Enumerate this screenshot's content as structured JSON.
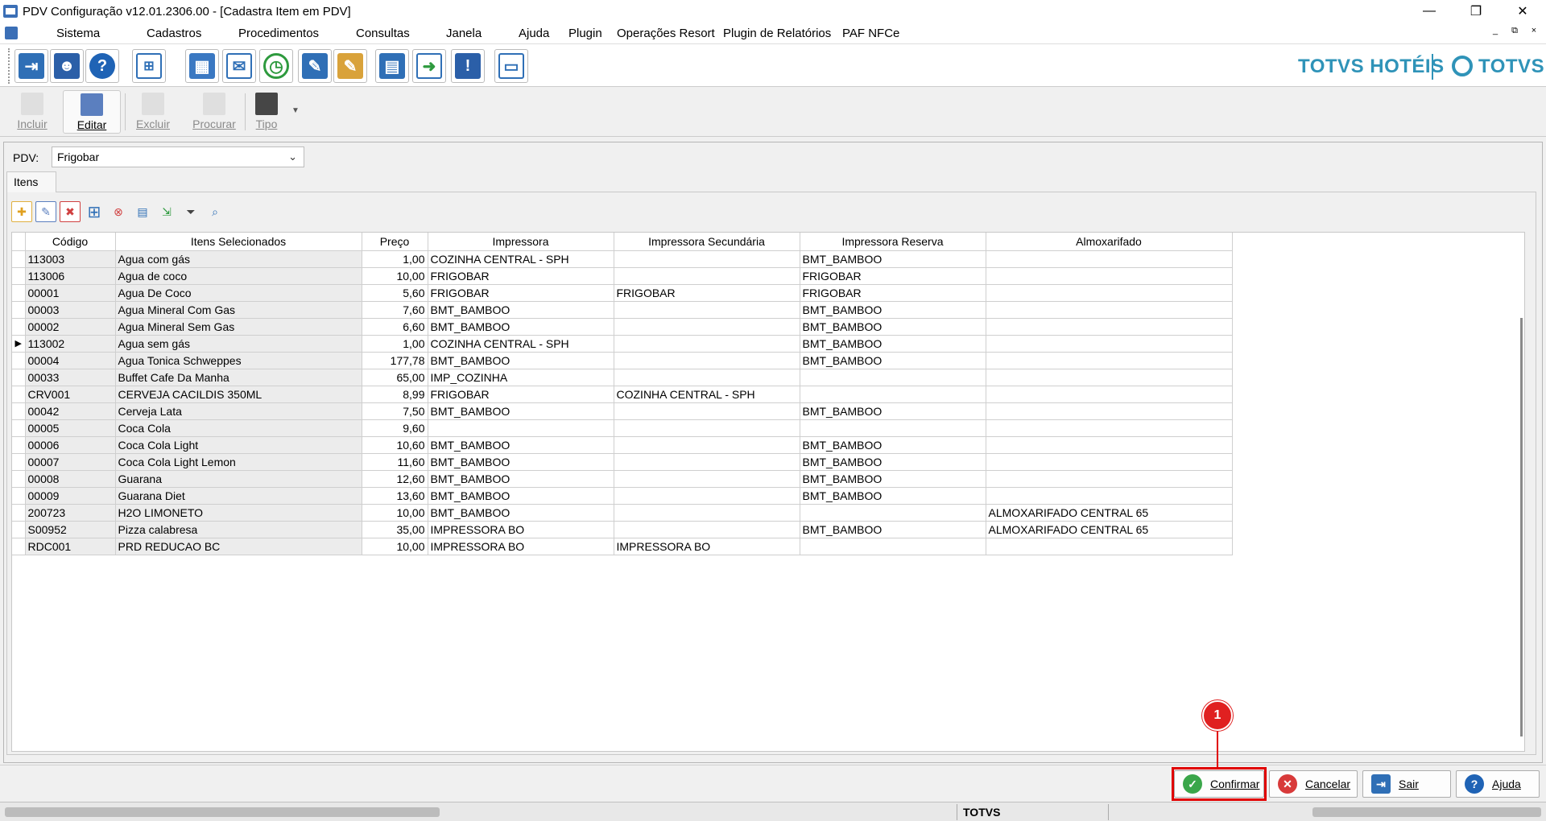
{
  "window": {
    "title": "PDV Configuração v12.01.2306.00 - [Cadastra Item em PDV]",
    "controls": [
      "—",
      "❐",
      "✕"
    ]
  },
  "menu": {
    "items": [
      "Sistema",
      "Cadastros",
      "Procedimentos",
      "Consultas",
      "Janela",
      "Ajuda",
      "Plugin",
      "Operações Resort",
      "Plugin de Relatórios",
      "PAF NFCe"
    ],
    "mdi_controls": [
      "_",
      "⧉",
      "×"
    ]
  },
  "brand": {
    "name": "TOTVS HOTÉIS",
    "logo_text": "TOTVS",
    "color": "#2f93b8"
  },
  "toolbar": {
    "incluir": "Incluir",
    "editar": "Editar",
    "excluir": "Excluir",
    "procurar": "Procurar",
    "tipo": "Tipo"
  },
  "form": {
    "pdv_label": "PDV:",
    "pdv_value": "Frigobar",
    "tab_label": "Itens"
  },
  "grid": {
    "headers": [
      "Código",
      "Itens Selecionados",
      "Preço",
      "Impressora",
      "Impressora Secundária",
      "Impressora Reserva",
      "Almoxarifado"
    ],
    "rows": [
      {
        "indicator": "",
        "codigo": "113003",
        "item": "Agua com gás",
        "preco": "1,00",
        "impressora": "COZINHA CENTRAL - SPH",
        "secundaria": "",
        "reserva": "BMT_BAMBOO",
        "almox": ""
      },
      {
        "indicator": "",
        "codigo": "113006",
        "item": "Agua de coco",
        "preco": "10,00",
        "impressora": "FRIGOBAR",
        "secundaria": "",
        "reserva": "FRIGOBAR",
        "almox": ""
      },
      {
        "indicator": "",
        "codigo": "00001",
        "item": "Agua De Coco",
        "preco": "5,60",
        "impressora": "FRIGOBAR",
        "secundaria": "FRIGOBAR",
        "reserva": "FRIGOBAR",
        "almox": ""
      },
      {
        "indicator": "",
        "codigo": "00003",
        "item": "Agua Mineral Com Gas",
        "preco": "7,60",
        "impressora": "BMT_BAMBOO",
        "secundaria": "",
        "reserva": "BMT_BAMBOO",
        "almox": ""
      },
      {
        "indicator": "",
        "codigo": "00002",
        "item": "Agua Mineral Sem Gas",
        "preco": "6,60",
        "impressora": "BMT_BAMBOO",
        "secundaria": "",
        "reserva": "BMT_BAMBOO",
        "almox": ""
      },
      {
        "indicator": "▶",
        "codigo": "113002",
        "item": "Agua sem gás",
        "preco": "1,00",
        "impressora": "COZINHA CENTRAL - SPH",
        "secundaria": "",
        "reserva": "BMT_BAMBOO",
        "almox": ""
      },
      {
        "indicator": "",
        "codigo": "00004",
        "item": "Agua Tonica Schweppes",
        "preco": "177,78",
        "impressora": "BMT_BAMBOO",
        "secundaria": "",
        "reserva": "BMT_BAMBOO",
        "almox": ""
      },
      {
        "indicator": "",
        "codigo": "00033",
        "item": "Buffet Cafe Da Manha",
        "preco": "65,00",
        "impressora": "IMP_COZINHA",
        "secundaria": "",
        "reserva": "",
        "almox": ""
      },
      {
        "indicator": "",
        "codigo": "CRV001",
        "item": "CERVEJA CACILDIS 350ML",
        "preco": "8,99",
        "impressora": "FRIGOBAR",
        "secundaria": "COZINHA CENTRAL - SPH",
        "reserva": "",
        "almox": ""
      },
      {
        "indicator": "",
        "codigo": "00042",
        "item": "Cerveja Lata",
        "preco": "7,50",
        "impressora": "BMT_BAMBOO",
        "secundaria": "",
        "reserva": "BMT_BAMBOO",
        "almox": ""
      },
      {
        "indicator": "",
        "codigo": "00005",
        "item": "Coca Cola",
        "preco": "9,60",
        "impressora": "",
        "secundaria": "",
        "reserva": "",
        "almox": ""
      },
      {
        "indicator": "",
        "codigo": "00006",
        "item": "Coca Cola Light",
        "preco": "10,60",
        "impressora": "BMT_BAMBOO",
        "secundaria": "",
        "reserva": "BMT_BAMBOO",
        "almox": ""
      },
      {
        "indicator": "",
        "codigo": "00007",
        "item": "Coca Cola Light Lemon",
        "preco": "11,60",
        "impressora": "BMT_BAMBOO",
        "secundaria": "",
        "reserva": "BMT_BAMBOO",
        "almox": ""
      },
      {
        "indicator": "",
        "codigo": "00008",
        "item": "Guarana",
        "preco": "12,60",
        "impressora": "BMT_BAMBOO",
        "secundaria": "",
        "reserva": "BMT_BAMBOO",
        "almox": ""
      },
      {
        "indicator": "",
        "codigo": "00009",
        "item": "Guarana Diet",
        "preco": "13,60",
        "impressora": "BMT_BAMBOO",
        "secundaria": "",
        "reserva": "BMT_BAMBOO",
        "almox": ""
      },
      {
        "indicator": "",
        "codigo": "200723",
        "item": "H2O LIMONETO",
        "preco": "10,00",
        "impressora": "BMT_BAMBOO",
        "secundaria": "",
        "reserva": "",
        "almox": "ALMOXARIFADO CENTRAL 65"
      },
      {
        "indicator": "",
        "codigo": "S00952",
        "item": "Pizza calabresa",
        "preco": "35,00",
        "impressora": "IMPRESSORA BO",
        "secundaria": "",
        "reserva": "BMT_BAMBOO",
        "almox": "ALMOXARIFADO CENTRAL 65"
      },
      {
        "indicator": "",
        "codigo": "RDC001",
        "item": "PRD REDUCAO BC",
        "preco": "10,00",
        "impressora": "IMPRESSORA BO",
        "secundaria": "IMPRESSORA BO",
        "reserva": "",
        "almox": ""
      }
    ]
  },
  "actions": {
    "confirmar": "Confirmar",
    "cancelar": "Cancelar",
    "sair": "Sair",
    "ajuda": "Ajuda"
  },
  "annotation": {
    "number": "1",
    "color": "#e00000"
  },
  "status": {
    "center": "TOTVS"
  }
}
